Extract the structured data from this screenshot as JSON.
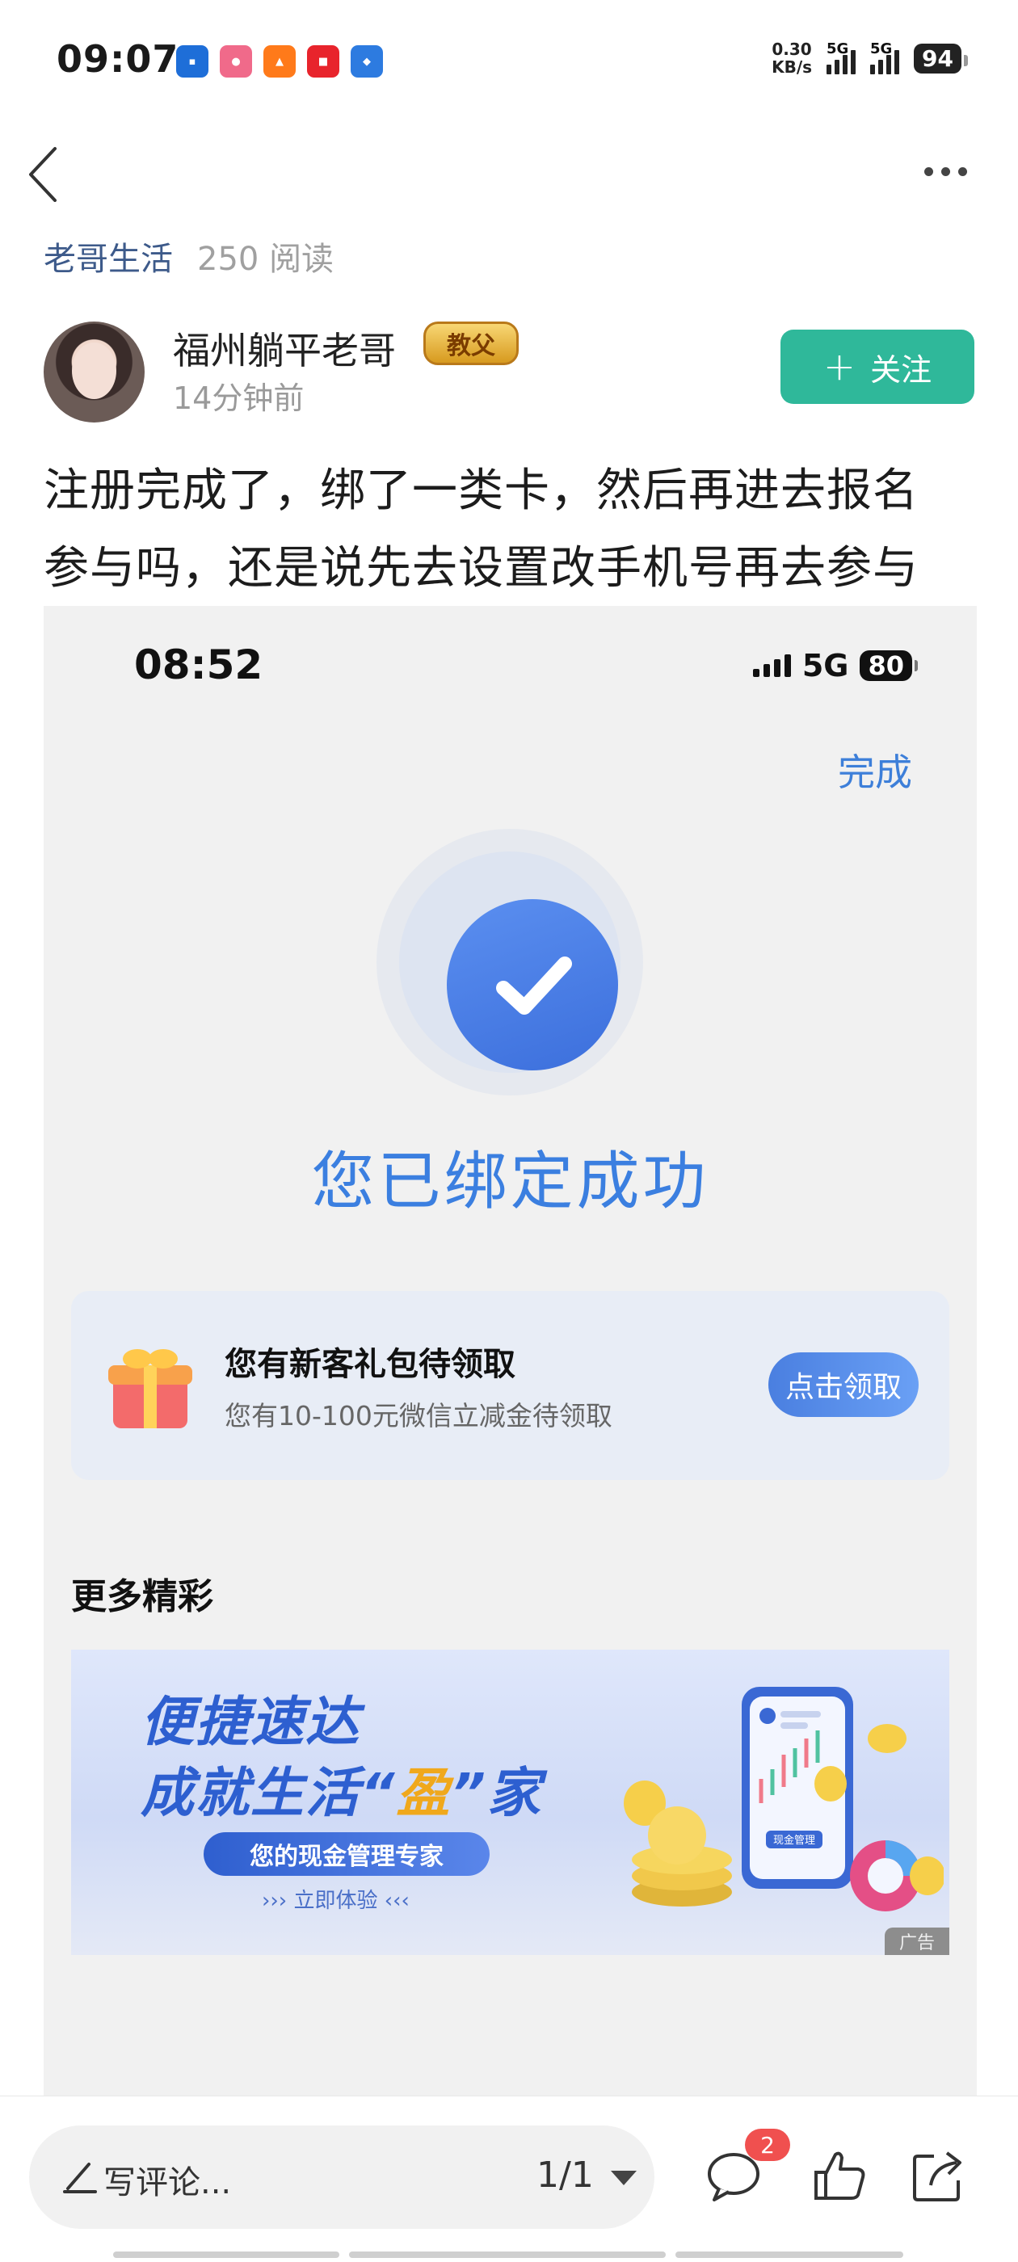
{
  "status_bar": {
    "time": "09:07",
    "speed_value": "0.30",
    "speed_unit": "KB/s",
    "network_1": "5G",
    "network_2": "5G",
    "battery": "94"
  },
  "nav": {
    "back_icon": "chevron-left-icon",
    "more_icon": "more-dots-icon"
  },
  "channel": {
    "name": "老哥生活",
    "reads": "250 阅读"
  },
  "author": {
    "name": "福州躺平老哥",
    "badge": "教父",
    "time": "14分钟前",
    "follow_label": "关注",
    "follow_icon": "plus-icon"
  },
  "post": {
    "line1": "注册完成了，绑了一类卡，然后再进去报名",
    "line2": "参与吗，还是说先去设置改手机号再去参与"
  },
  "screenshot": {
    "time": "08:52",
    "network": "5G",
    "battery": "80",
    "done_label": "完成",
    "success_title": "您已绑定成功",
    "gift": {
      "title": "您有新客礼包待领取",
      "subtitle": "您有10-100元微信立减金待领取",
      "button": "点击领取"
    },
    "more_title": "更多精彩",
    "ad": {
      "line1": "便捷速达",
      "line2_pre": "成就生活“",
      "line2_hi": "盈",
      "line2_post": "”家",
      "pill": "您的现金管理专家",
      "cta": "››› 立即体验 ‹‹‹",
      "phone_label": "现金管理",
      "tag": "广告"
    }
  },
  "bottom_bar": {
    "comment_placeholder": "写评论...",
    "page": "1/1",
    "comment_count": "2",
    "icons": [
      "pen-icon",
      "comment-icon",
      "like-icon",
      "share-icon"
    ]
  },
  "colors": {
    "accent_green": "#2fb89a",
    "accent_blue": "#3b7fe0",
    "badge_red": "#f0504f"
  }
}
